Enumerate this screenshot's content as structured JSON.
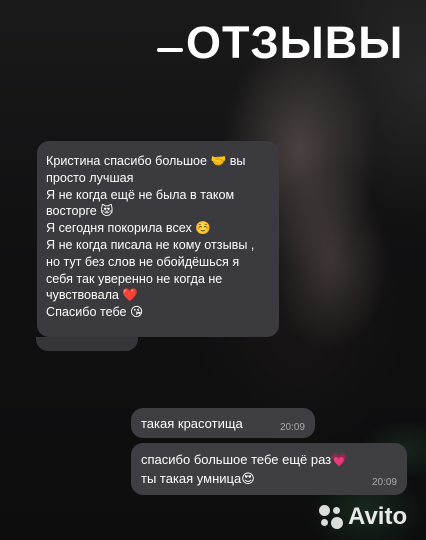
{
  "header": {
    "title": "ОТЗЫВЫ"
  },
  "review": {
    "lines": [
      "Кристина спасибо большое 🤝 вы",
      "просто лучшая",
      "Я не когда ещё не была в таком",
      "восторге 😻",
      "Я сегодня покорила всех ☺️",
      "Я не когда писала не кому отзывы ,",
      "но тут без слов не обойдёшься  я",
      "себя так уверенно не когда не",
      "чувствовала ❤️",
      "Спасибо тебе 😘"
    ]
  },
  "messages": [
    {
      "text": "такая красотища",
      "time": "20:09"
    },
    {
      "line1": "спасибо большое тебе ещё раз💗",
      "line2": "ты такая умница😍",
      "time": "20:09"
    }
  ],
  "watermark": {
    "brand": "Avito",
    "icon": "avito-dots-icon"
  },
  "colors": {
    "bubble": "#3b3a3e",
    "text": "#ffffff",
    "background": "#0c0c0d"
  }
}
